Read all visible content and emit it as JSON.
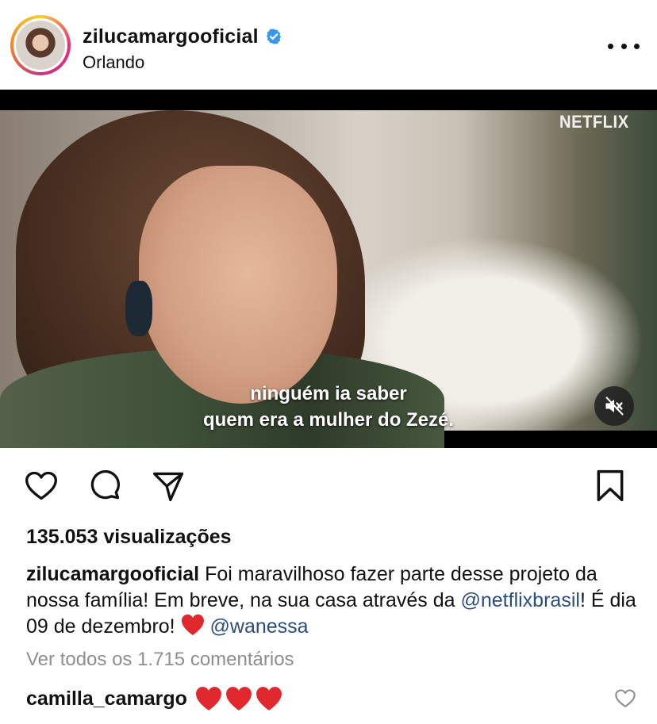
{
  "post": {
    "username": "zilucamargooficial",
    "location": "Orlando",
    "verified": true,
    "icons": {
      "verified": "verified-badge-icon",
      "more": "more-options-icon"
    }
  },
  "video": {
    "brand": "NETFLIX",
    "subtitle_line1": "ninguém ia saber",
    "subtitle_line2": "quem era a mulher do Zezé.",
    "mute_icon": "muted-speaker-icon"
  },
  "actions": {
    "like": "heart-icon",
    "comment": "comment-icon",
    "share": "send-icon",
    "save": "bookmark-icon"
  },
  "views": "135.053 visualizações",
  "caption": {
    "user": "zilucamargooficial",
    "text_part1": "Foi maravilhoso fazer parte desse projeto da nossa família! Em breve, na sua casa através da ",
    "mention1": "@netflixbrasil",
    "text_part2": "! É dia 09 de dezembro! ",
    "mention2": "@wanessa"
  },
  "view_all_comments": "Ver todos os 1.715 comentários",
  "comment": {
    "user": "camilla_camargo",
    "hearts": 3
  },
  "colors": {
    "mention": "#2b4d7e",
    "verified": "#3897f0",
    "heart_emoji": "#e0282e",
    "muted_text": "#8e8e8e"
  }
}
